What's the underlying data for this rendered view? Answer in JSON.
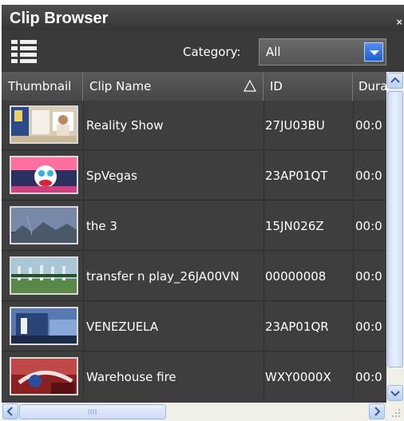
{
  "window": {
    "title": "Clip Browser",
    "close_glyph": "×"
  },
  "toolbar": {
    "view_icon": "list-view-icon",
    "category_label": "Category:",
    "category_value": "All"
  },
  "columns": [
    "Thumbnail",
    "Clip Name",
    "ID",
    "Dura"
  ],
  "sort": {
    "column": "Clip Name",
    "indicator": "ascending-triangle"
  },
  "clips": [
    {
      "name": "Reality Show",
      "id": "27JU03BU",
      "duration": "00:0"
    },
    {
      "name": "SpVegas",
      "id": "23AP01QT",
      "duration": "00:0"
    },
    {
      "name": "the 3",
      "id": "15JN026Z",
      "duration": "00:0"
    },
    {
      "name": "transfer n play_26JA00VN",
      "id": "00000008",
      "duration": "00:0"
    },
    {
      "name": "VENEZUELA",
      "id": "23AP01QR",
      "duration": "00:0"
    },
    {
      "name": "Warehouse fire",
      "id": "WXY0000X",
      "duration": "00:0"
    }
  ],
  "colors": {
    "panel_bg": "#3c3c3c",
    "header_bg": "#4f4f4f",
    "accent": "#2d6fe0",
    "scrollbar": "#f0efe8"
  }
}
